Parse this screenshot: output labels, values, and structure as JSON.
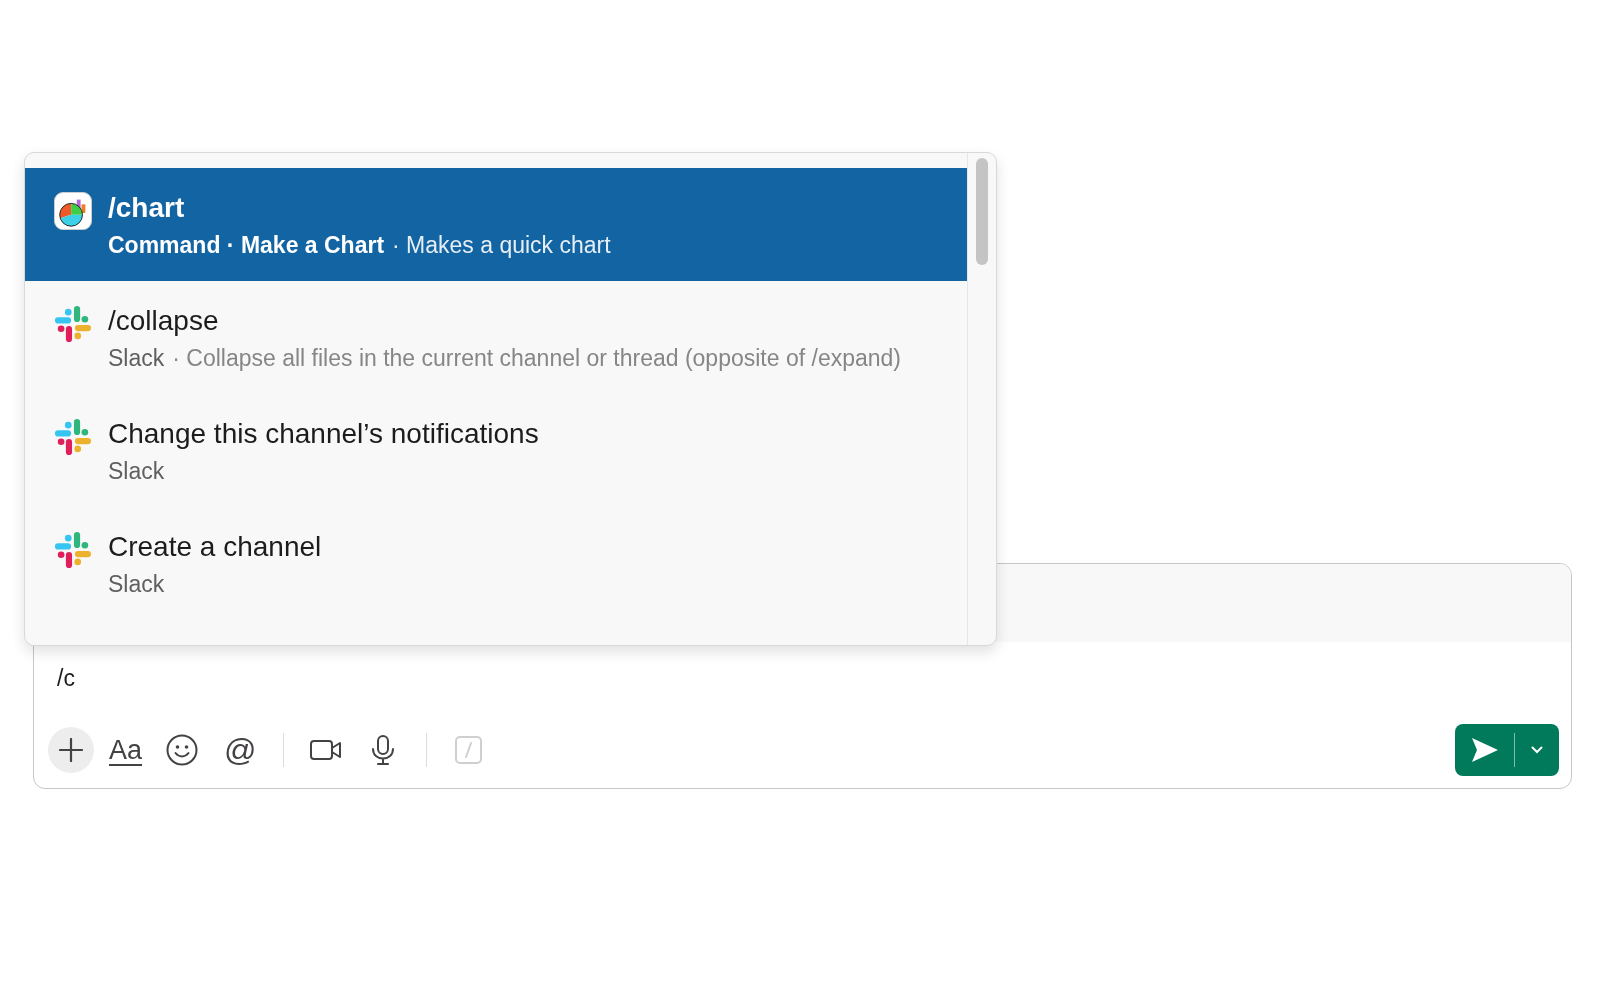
{
  "autocomplete": {
    "items": [
      {
        "kind": "chart",
        "title": "/chart",
        "source": "Command · Make a Chart",
        "description": "· Makes a quick chart",
        "selected": true
      },
      {
        "kind": "slack",
        "title": "/collapse",
        "source": "Slack",
        "description": "· Collapse all files in the current channel or thread (opposite of /expand)",
        "selected": false
      },
      {
        "kind": "slack",
        "title": "Change this channel’s notifications",
        "source": "Slack",
        "selected": false
      },
      {
        "kind": "slack",
        "title": "Create a channel",
        "source": "Slack",
        "selected": false
      }
    ]
  },
  "composer": {
    "value": "/c",
    "toolbar": {
      "format_label": "Aa",
      "mention_label": "@"
    }
  }
}
